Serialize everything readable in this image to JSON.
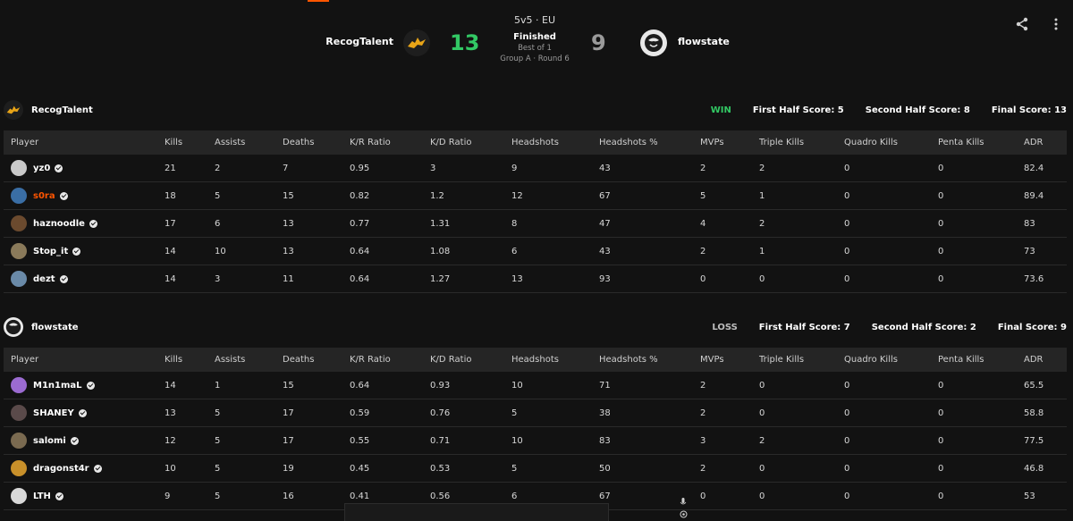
{
  "match": {
    "format": "5v5 · EU",
    "status": "Finished",
    "best_of": "Best of 1",
    "group": "Group A · Round 6"
  },
  "team_a": {
    "name": "RecogTalent",
    "score": "13",
    "result": "WIN",
    "first_half": "First Half Score: 5",
    "second_half": "Second Half Score: 8",
    "final": "Final Score: 13"
  },
  "team_b": {
    "name": "flowstate",
    "score": "9",
    "result": "LOSS",
    "first_half": "First Half Score: 7",
    "second_half": "Second Half Score: 2",
    "final": "Final Score: 9"
  },
  "columns": [
    "Player",
    "Kills",
    "Assists",
    "Deaths",
    "K/R Ratio",
    "K/D Ratio",
    "Headshots",
    "Headshots %",
    "MVPs",
    "Triple Kills",
    "Quadro Kills",
    "Penta Kills",
    "ADR"
  ],
  "team_a_players": [
    {
      "name": "yz0",
      "avatar_color": "#c9c9c9",
      "stats": [
        "21",
        "2",
        "7",
        "0.95",
        "3",
        "9",
        "43",
        "2",
        "2",
        "0",
        "0",
        "82.4"
      ]
    },
    {
      "name": "s0ra",
      "avatar_color": "#3a6ea5",
      "highlight": true,
      "stats": [
        "18",
        "5",
        "15",
        "0.82",
        "1.2",
        "12",
        "67",
        "5",
        "1",
        "0",
        "0",
        "89.4"
      ]
    },
    {
      "name": "haznoodle",
      "avatar_color": "#6b4a2e",
      "stats": [
        "17",
        "6",
        "13",
        "0.77",
        "1.31",
        "8",
        "47",
        "4",
        "2",
        "0",
        "0",
        "83"
      ]
    },
    {
      "name": "Stop_it",
      "avatar_color": "#8a7a5a",
      "stats": [
        "14",
        "10",
        "13",
        "0.64",
        "1.08",
        "6",
        "43",
        "2",
        "1",
        "0",
        "0",
        "73"
      ]
    },
    {
      "name": "dezt",
      "avatar_color": "#6a8aa8",
      "stats": [
        "14",
        "3",
        "11",
        "0.64",
        "1.27",
        "13",
        "93",
        "0",
        "0",
        "0",
        "0",
        "73.6"
      ]
    }
  ],
  "team_b_players": [
    {
      "name": "M1n1maL",
      "avatar_color": "#9b6bd1",
      "stats": [
        "14",
        "1",
        "15",
        "0.64",
        "0.93",
        "10",
        "71",
        "2",
        "0",
        "0",
        "0",
        "65.5"
      ]
    },
    {
      "name": "SHANEY",
      "avatar_color": "#5a4a4a",
      "stats": [
        "13",
        "5",
        "17",
        "0.59",
        "0.76",
        "5",
        "38",
        "2",
        "0",
        "0",
        "0",
        "58.8"
      ]
    },
    {
      "name": "salomi",
      "avatar_color": "#7a6a50",
      "stats": [
        "12",
        "5",
        "17",
        "0.55",
        "0.71",
        "10",
        "83",
        "3",
        "2",
        "0",
        "0",
        "77.5"
      ]
    },
    {
      "name": "dragonst4r",
      "avatar_color": "#c8902a",
      "stats": [
        "10",
        "5",
        "19",
        "0.45",
        "0.53",
        "5",
        "50",
        "2",
        "0",
        "0",
        "0",
        "46.8"
      ]
    },
    {
      "name": "LTH",
      "avatar_color": "#d8d8d8",
      "stats": [
        "9",
        "5",
        "16",
        "0.41",
        "0.56",
        "6",
        "67",
        "0",
        "0",
        "0",
        "0",
        "53"
      ]
    }
  ],
  "colors": {
    "accent": "#ff5500",
    "win": "#32c864",
    "background": "#121212",
    "header_row": "#252525"
  },
  "icons": {
    "share": "share-icon",
    "more": "more-vertical-icon",
    "verified": "verified-check-icon"
  }
}
